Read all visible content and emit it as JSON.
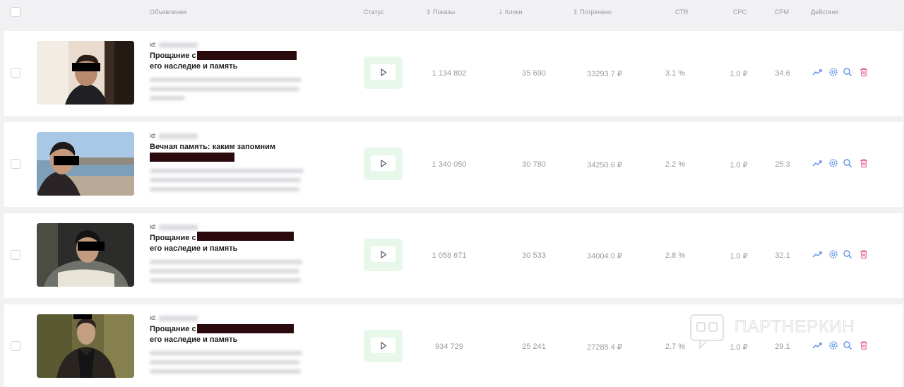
{
  "header": {
    "ads": "Объявления",
    "status": "Статус",
    "shows": "Показы",
    "clicks": "Клики",
    "spent": "Потрачено",
    "ctr": "CTR",
    "cpc": "CPC",
    "cpm": "CPM",
    "actions": "Действия"
  },
  "colors": {
    "status_bg": "#e7f8ea",
    "action_blue": "#5b8fe8",
    "action_delete": "#e8699a"
  },
  "rows": [
    {
      "id_prefix": "id:",
      "title_line1": "Прощание с",
      "title_line2": "его наследие и память",
      "shows": "1 134 802",
      "clicks": "35 690",
      "spent": "33293.7 ₽",
      "ctr": "3.1 %",
      "cpc": "1.0 ₽",
      "cpm": "34.6"
    },
    {
      "id_prefix": "id:",
      "title_line1": "Вечная память: каким запомним",
      "title_line2": "",
      "shows": "1 340 050",
      "clicks": "30 780",
      "spent": "34250.6 ₽",
      "ctr": "2.2 %",
      "cpc": "1.0 ₽",
      "cpm": "25.3"
    },
    {
      "id_prefix": "id:",
      "title_line1": "Прощание с",
      "title_line2": "его наследие и память",
      "shows": "1 058 671",
      "clicks": "30 533",
      "spent": "34004.0 ₽",
      "ctr": "2.8 %",
      "cpc": "1.0 ₽",
      "cpm": "32.1"
    },
    {
      "id_prefix": "id:",
      "title_line1": "Прощание с",
      "title_line2": "его наследие и память",
      "shows": "934 729",
      "clicks": "25 241",
      "spent": "27285.4 ₽",
      "ctr": "2.7 %",
      "cpc": "1.0 ₽",
      "cpm": "29.1"
    }
  ],
  "watermark": {
    "text": "ПАРТНЕРКИН"
  }
}
